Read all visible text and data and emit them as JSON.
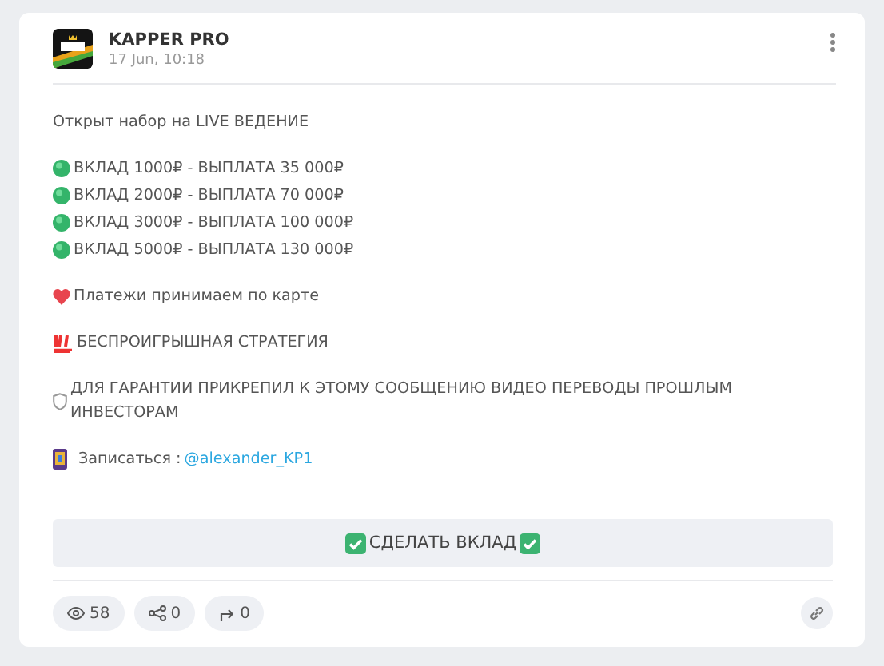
{
  "post": {
    "channel": "KAPPER PRO",
    "date": "17 Jun, 10:18"
  },
  "paragraphs": [
    {
      "lines": [
        {
          "kind": "plain",
          "text": "Открыт набор на LIVE ВЕДЕНИЕ"
        }
      ]
    },
    {
      "lines": [
        {
          "kind": "dot",
          "text": "ВКЛАД 1000₽ - ВЫПЛАТА 35 000₽"
        },
        {
          "kind": "dot",
          "text": "ВКЛАД 2000₽ - ВЫПЛАТА 70 000₽"
        },
        {
          "kind": "dot",
          "text": "ВКЛАД 3000₽ - ВЫПЛАТА 100 000₽"
        },
        {
          "kind": "dot",
          "text": "ВКЛАД 5000₽ - ВЫПЛАТА 130 000₽"
        }
      ]
    },
    {
      "lines": [
        {
          "kind": "heart",
          "text": "Платежи принимаем по карте"
        }
      ]
    },
    {
      "lines": [
        {
          "kind": "hundred",
          "text": "БЕСПРОИГРЫШНАЯ СТРАТЕГИЯ"
        }
      ]
    },
    {
      "lines": [
        {
          "kind": "shield",
          "text": "ДЛЯ ГАРАНТИИ ПРИКРЕПИЛ К ЭТОМУ СООБЩЕНИЮ ВИДЕО ПЕРЕВОДЫ ПРОШЛЫМ ИНВЕСТОРАМ"
        }
      ]
    },
    {
      "lines": [
        {
          "kind": "phone",
          "text": "Записаться :",
          "link": "@alexander_KP1"
        }
      ]
    }
  ],
  "action_button": "СДЕЛАТЬ ВКЛАД",
  "stats": [
    {
      "kind": "views",
      "value": "58"
    },
    {
      "kind": "shares",
      "value": "0"
    },
    {
      "kind": "forwards",
      "value": "0"
    }
  ]
}
